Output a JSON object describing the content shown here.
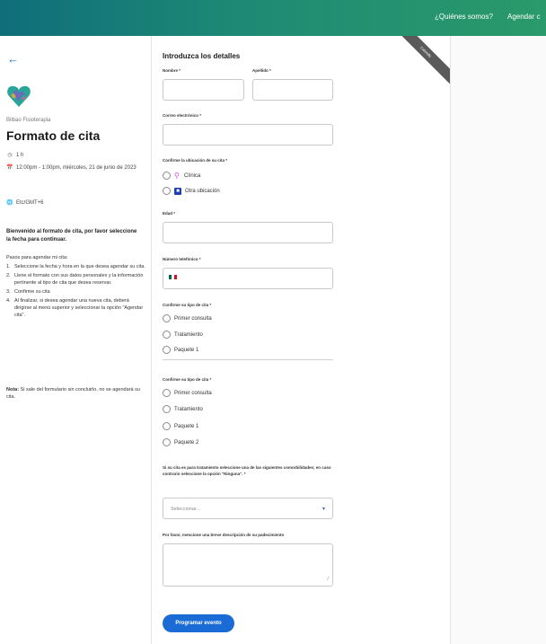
{
  "topbar": {
    "nav_about": "¿Quiénes somos?",
    "nav_schedule": "Agendar c"
  },
  "sidebar": {
    "back_icon": "arrow-left-icon",
    "org_name": "Bilbao Fisioterapia",
    "title": "Formato de cita",
    "duration": "1 h",
    "datetime": "12:00pm - 1:00pm, miércoles, 21 de junio de 2023",
    "timezone": "Etc/GMT+6",
    "intro": "Bienvenido al formato de cita, por favor seleccione la fecha para continuar.",
    "steps_title": "Pasos para agendar mi cita:",
    "steps": [
      {
        "n": "1.",
        "text": "Seleccione la fecha y hora en la que desea agendar su cita."
      },
      {
        "n": "2.",
        "text": "Llene el formato con sus datos personales y la información pertinente al tipo de cita que desea reservar."
      },
      {
        "n": "3.",
        "text": "Confirme su cita"
      },
      {
        "n": "4.",
        "text": "Al finalizar, si desea agendar una nueva cita, deberá dirigirse al menú superior y seleccionar la opción \"Agendar cita\"."
      }
    ],
    "note_label": "Nota:",
    "note_text": "Si sale del formulario sin concluirlo, no se agendará su cita."
  },
  "form": {
    "ribbon": "Calendly",
    "heading": "Introduzca los detalles",
    "nombre_label": "Nombre *",
    "apellido_label": "Apellido *",
    "email_label": "Correo electrónico *",
    "location_label": "Confirme la ubicación de su cita *",
    "location_options": [
      "Clínica",
      "Otra ubicación"
    ],
    "edad_label": "Edad *",
    "phone_label": "Número telefónico *",
    "tipo_label_1": "Confirme su tipo de cita *",
    "tipo_options_1": [
      "Primer consulta",
      "Tratamiento",
      "Paquete 1"
    ],
    "tipo_label_2": "Confirme su tipo de cita *",
    "tipo_options_2": [
      "Primer consulta",
      "Tratamiento",
      "Paquete 1",
      "Paquete 2"
    ],
    "comorbidity_label": "Si su cita es para tratamiento seleccione una de las siguientes comorbilidades; en caso contrario seleccione la opción \"Ninguna\". *",
    "select_placeholder": "Seleccionar...",
    "description_label": "Por favor, mencione una breve descripción de su padecimiento",
    "submit_label": "Programar evento"
  }
}
